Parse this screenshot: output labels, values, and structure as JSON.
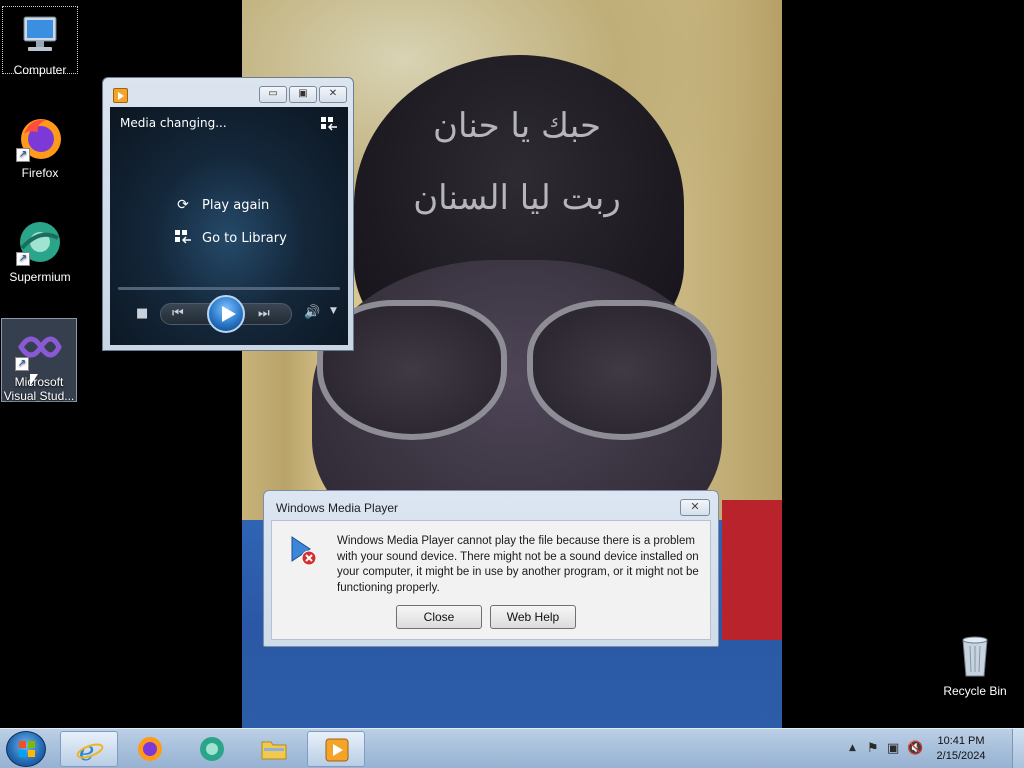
{
  "desktop": {
    "icons": [
      {
        "label": "Computer"
      },
      {
        "label": "Firefox"
      },
      {
        "label": "Supermium"
      },
      {
        "label": "Microsoft Visual Stud..."
      },
      {
        "label": "Recycle Bin"
      }
    ],
    "wallpaper_text": [
      "حبك يا حنان",
      "ربت ليا السنان"
    ]
  },
  "wmp": {
    "status": "Media changing...",
    "options": {
      "play_again": "Play again",
      "go_to_library": "Go to Library"
    },
    "title_buttons": {
      "minimize": "▭",
      "restore": "▣",
      "close": "✕"
    }
  },
  "dialog": {
    "title": "Windows Media Player",
    "message": "Windows Media Player cannot play the file because there is a problem with your sound device. There might not be a sound device installed on your computer, it might be in use by another program, or it might not be functioning properly.",
    "buttons": {
      "close": "Close",
      "web_help": "Web Help"
    },
    "close_glyph": "✕"
  },
  "taskbar": {
    "pinned": [
      "internet-explorer",
      "firefox",
      "supermium",
      "file-explorer",
      "windows-media-player"
    ],
    "clock": {
      "time": "10:41 PM",
      "date": "2/15/2024"
    }
  },
  "colors": {
    "taskbar": "#a9c1dc",
    "dialog_bg": "#f2f2f2",
    "wmp_screen": "#14273a",
    "accent_blue": "#2a78c9"
  }
}
